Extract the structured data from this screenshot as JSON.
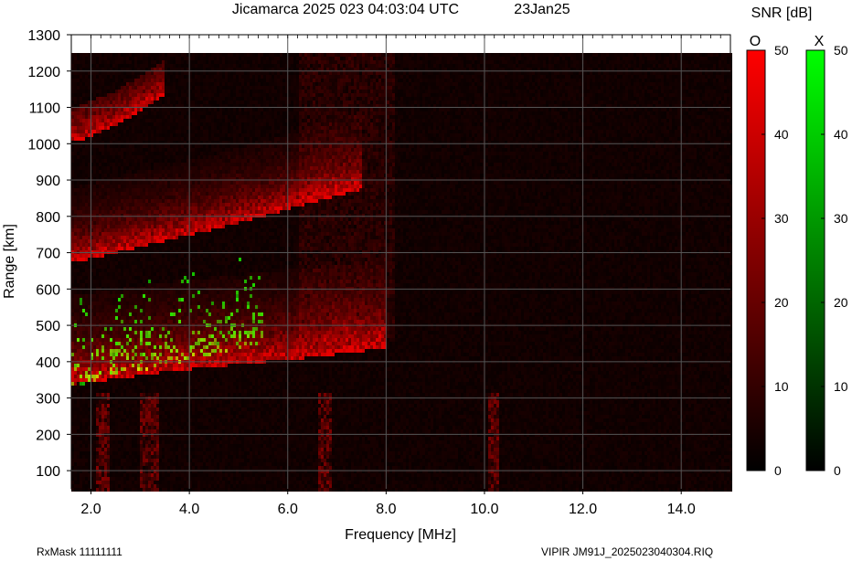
{
  "chart_data": {
    "type": "heatmap",
    "title": "Jicamarca 2025 023 04:03:04 UTC",
    "date_label": "23Jan25",
    "xlabel": "Frequency [MHz]",
    "ylabel": "Range [km]",
    "xlim": [
      1.6,
      15.0
    ],
    "ylim": [
      50,
      1300
    ],
    "x_ticks": [
      "2.0",
      "4.0",
      "6.0",
      "8.0",
      "10.0",
      "12.0",
      "14.0"
    ],
    "x_tick_values": [
      2,
      4,
      6,
      8,
      10,
      12,
      14
    ],
    "y_ticks": [
      "100",
      "200",
      "300",
      "400",
      "500",
      "600",
      "700",
      "800",
      "900",
      "1000",
      "1100",
      "1200",
      "1300"
    ],
    "y_tick_values": [
      100,
      200,
      300,
      400,
      500,
      600,
      700,
      800,
      900,
      1000,
      1100,
      1200,
      1300
    ],
    "grid": true,
    "background": "#000000",
    "colorbar_title": "SNR [dB]",
    "colorbars": [
      {
        "name": "O",
        "color": "#ff0000",
        "range": [
          0,
          50
        ],
        "ticks": [
          "0",
          "10",
          "20",
          "30",
          "40",
          "50"
        ],
        "tick_values": [
          0,
          10,
          20,
          30,
          40,
          50
        ]
      },
      {
        "name": "X",
        "color": "#00ff00",
        "range": [
          0,
          50
        ],
        "ticks": [
          "0",
          "10",
          "20",
          "30",
          "40",
          "50"
        ],
        "tick_values": [
          0,
          10,
          20,
          30,
          40,
          50
        ]
      }
    ],
    "traces": [
      {
        "mode": "O",
        "hop": "1F",
        "points": [
          [
            1.7,
            345
          ],
          [
            2.5,
            358
          ],
          [
            3.5,
            378
          ],
          [
            4.5,
            392
          ],
          [
            5.5,
            405
          ],
          [
            6.5,
            418
          ],
          [
            7.5,
            435
          ],
          [
            8.0,
            445
          ]
        ]
      },
      {
        "mode": "X",
        "hop": "1F",
        "points": [
          [
            1.7,
            340
          ],
          [
            2.5,
            365
          ],
          [
            3.5,
            395
          ],
          [
            4.5,
            425
          ],
          [
            5.5,
            460
          ]
        ]
      },
      {
        "mode": "O",
        "hop": "2F",
        "points": [
          [
            1.7,
            680
          ],
          [
            2.5,
            705
          ],
          [
            3.5,
            738
          ],
          [
            4.5,
            770
          ],
          [
            5.5,
            805
          ],
          [
            6.5,
            845
          ],
          [
            7.5,
            880
          ]
        ]
      },
      {
        "mode": "O",
        "hop": "3F",
        "points": [
          [
            1.7,
            1010
          ],
          [
            2.5,
            1055
          ],
          [
            3.0,
            1095
          ],
          [
            3.5,
            1140
          ]
        ]
      }
    ],
    "footer_left": "RxMask 11111111",
    "footer_right": "VIPIR  JM91J_2025023040304.RIQ"
  }
}
